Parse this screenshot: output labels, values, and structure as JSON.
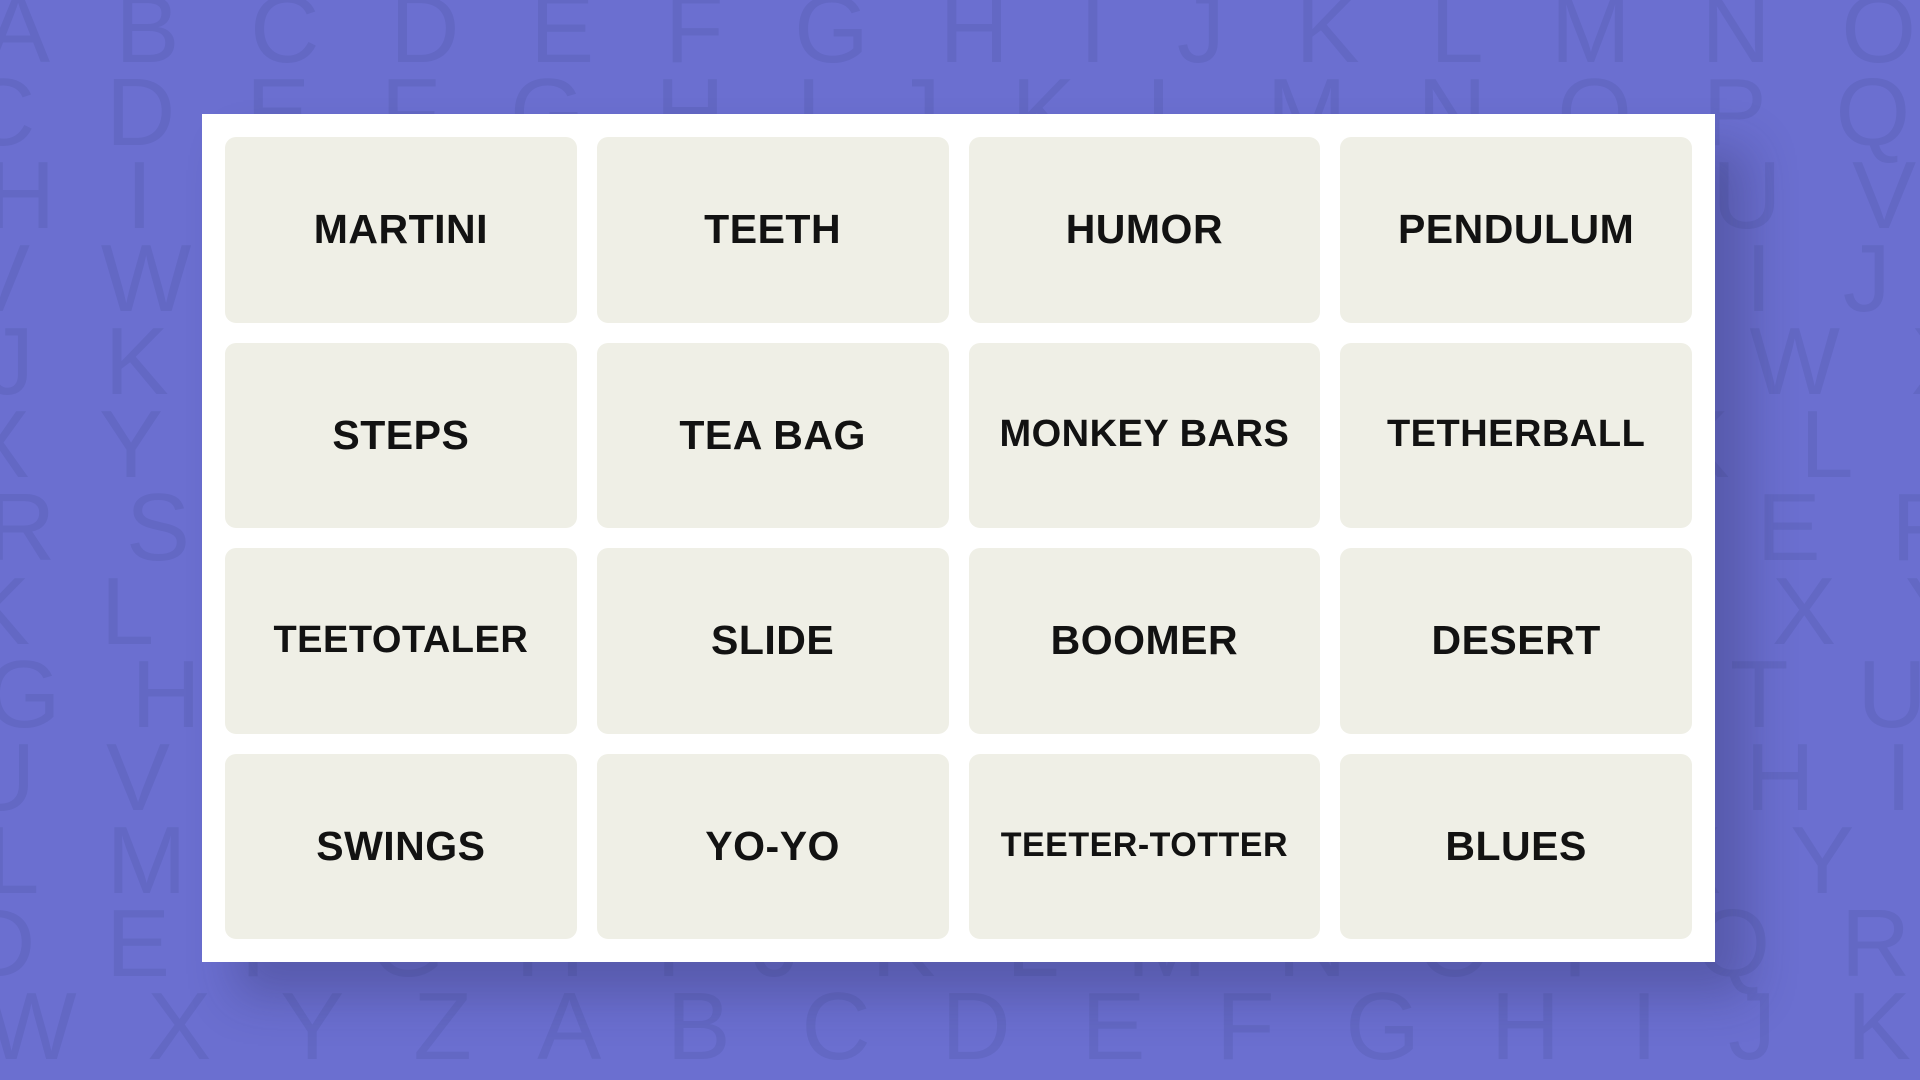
{
  "theme": {
    "background_color": "#6b6fd0",
    "pattern_letter_color": "#6368c4",
    "card_color": "#ffffff",
    "tile_color": "#efefe6",
    "tile_text_color": "#121212"
  },
  "background_pattern": {
    "type": "alphabet-watermark",
    "rows": [
      "A B C D E F G H I J K L M N O P Q R S T U V W X Y Z A B C D E F G",
      "C D E F G H I J K L M N O P Q R S T U V W X Y Z A B C D E F G H I",
      "H I J K L M N O P Q R S T U V W X Y Z A B C D E F G H I J K L M N",
      "V W X Y Z A B C D E F G H I J K L M N O P Q R S T U V W X Y Z A B",
      "J K L M N O P Q R S T U V W X Y Z A B C D E F G H I J K L M N O P",
      "X Y Z A B C D E F G H I J K L M N O P Q R S T U V W X Y Z A B C D",
      "R S T U V W X Y Z A B C D E F G H I J K L M N O P Q R S T U V W X",
      "K L M N O P Q R S T U V W X Y Z A B C D E F G H I J K L M N O P Q",
      "G H I J K L M N O P Q R S T U V W X Y Z A B C D E F G H I J K L M",
      "U V W X Y Z A B C D E F G H I J K L M N O P Q R S T U V W X Y Z A",
      "L M N O P Q R S T U V W X Y Z A B C D E F G H I J K L M N O P Q R",
      "D E F G H I J K L M N O P Q R S T U V W X Y Z A B C D E F G H I J",
      "W X Y Z A B C D E F G H I J K L M N O P Q R S T U V W X Y Z A B C"
    ]
  },
  "board": {
    "rows": 4,
    "columns": 4,
    "tiles": [
      {
        "word": "MARTINI",
        "row": 1,
        "col": 1,
        "selected": false
      },
      {
        "word": "TEETH",
        "row": 1,
        "col": 2,
        "selected": false
      },
      {
        "word": "HUMOR",
        "row": 1,
        "col": 3,
        "selected": false
      },
      {
        "word": "PENDULUM",
        "row": 1,
        "col": 4,
        "selected": false
      },
      {
        "word": "STEPS",
        "row": 2,
        "col": 1,
        "selected": false
      },
      {
        "word": "TEA BAG",
        "row": 2,
        "col": 2,
        "selected": false
      },
      {
        "word": "MONKEY BARS",
        "row": 2,
        "col": 3,
        "selected": false
      },
      {
        "word": "TETHERBALL",
        "row": 2,
        "col": 4,
        "selected": false
      },
      {
        "word": "TEETOTALER",
        "row": 3,
        "col": 1,
        "selected": false
      },
      {
        "word": "SLIDE",
        "row": 3,
        "col": 2,
        "selected": false
      },
      {
        "word": "BOOMER",
        "row": 3,
        "col": 3,
        "selected": false
      },
      {
        "word": "DESERT",
        "row": 3,
        "col": 4,
        "selected": false
      },
      {
        "word": "SWINGS",
        "row": 4,
        "col": 1,
        "selected": false
      },
      {
        "word": "YO-YO",
        "row": 4,
        "col": 2,
        "selected": false
      },
      {
        "word": "TEETER-TOTTER",
        "row": 4,
        "col": 3,
        "selected": false
      },
      {
        "word": "BLUES",
        "row": 4,
        "col": 4,
        "selected": false
      }
    ]
  }
}
